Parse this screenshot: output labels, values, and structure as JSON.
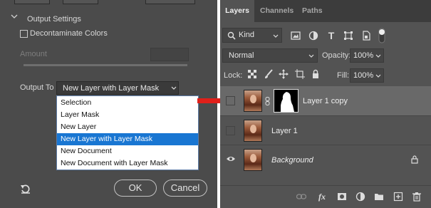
{
  "dialog": {
    "section_title": "Output Settings",
    "decontaminate_label": "Decontaminate Colors",
    "amount_label": "Amount",
    "output_to_label": "Output To",
    "output_to_value": "New Layer with Layer Mask",
    "dropdown_options": [
      "Selection",
      "Layer Mask",
      "New Layer",
      "New Layer with Layer Mask",
      "New Document",
      "New Document with Layer Mask"
    ],
    "selected_option": "New Layer with Layer Mask",
    "ok_label": "OK",
    "cancel_label": "Cancel",
    "reset_icon": "reset-icon"
  },
  "layers_panel": {
    "tabs": [
      "Layers",
      "Channels",
      "Paths"
    ],
    "active_tab": "Layers",
    "kind_label": "Kind",
    "blend_mode": "Normal",
    "opacity_label": "Opacity:",
    "opacity_value": "100%",
    "lock_label": "Lock:",
    "fill_label": "Fill:",
    "fill_value": "100%",
    "layers": [
      {
        "name": "Layer 1 copy",
        "visible": false,
        "has_mask": true,
        "selected": true
      },
      {
        "name": "Layer 1",
        "visible": false,
        "has_mask": false,
        "selected": false
      },
      {
        "name": "Background",
        "visible": true,
        "has_mask": false,
        "selected": false,
        "locked": true
      }
    ]
  },
  "colors": {
    "arrow": "#e0201a",
    "selection_highlight": "#1976d2",
    "panel_bg": "#535353",
    "dialog_bg": "#4b4b4b"
  }
}
